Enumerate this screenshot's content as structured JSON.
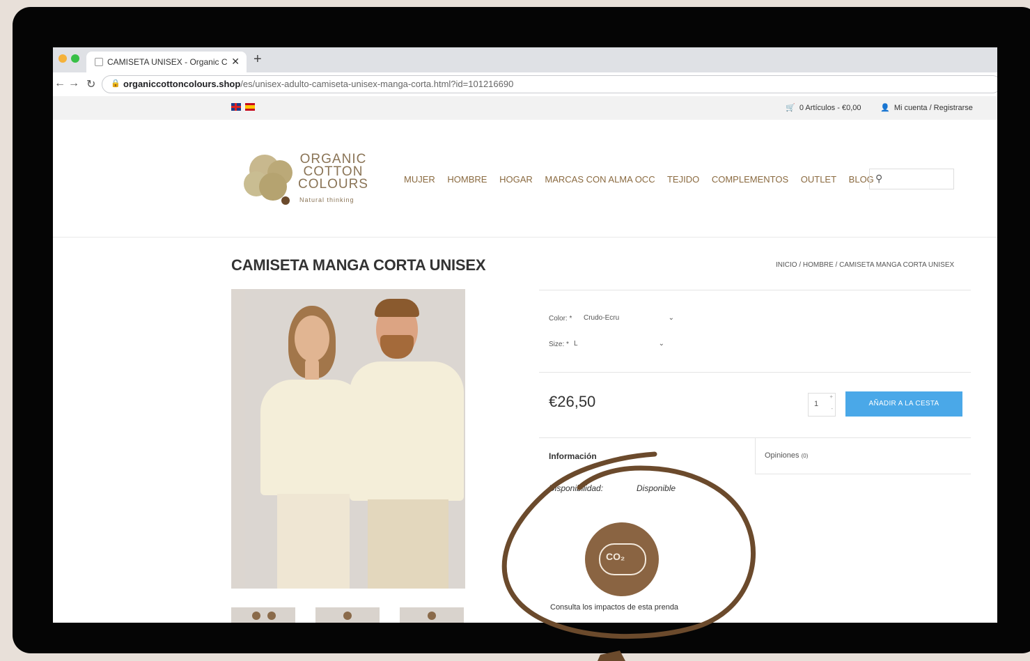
{
  "browser": {
    "tab_title": "CAMISETA UNISEX - Organic C",
    "tab_close": "✕",
    "new_tab": "+",
    "url_host": "organiccottoncolours.shop",
    "url_path": "/es/unisex-adulto-camiseta-unisex-manga-corta.html?id=101216690"
  },
  "topbar": {
    "cart": "0 Artículos - €0,00",
    "account": "Mi cuenta / Registrarse"
  },
  "logo": {
    "line1": "ORGANIC",
    "line2": "COTTON",
    "line3": "COLOURS",
    "tagline": "Natural thinking"
  },
  "nav": {
    "items": [
      "MUJER",
      "HOMBRE",
      "HOGAR",
      "MARCAS CON ALMA OCC",
      "TEJIDO",
      "COMPLEMENTOS",
      "OUTLET",
      "BLOG"
    ]
  },
  "product": {
    "title": "CAMISETA MANGA CORTA UNISEX",
    "breadcrumb": "INICIO / HOMBRE / CAMISETA MANGA CORTA UNISEX",
    "color_label": "Color: *",
    "color_value": "Crudo-Ecru",
    "size_label": "Size: *",
    "size_value": "L",
    "price": "€26,50",
    "qty": "1",
    "add_button": "AÑADIR A LA CESTA",
    "tab_info": "Información",
    "tab_reviews": "Opiniones",
    "tab_reviews_count": "(0)",
    "avail_label": "Disponibilidad:",
    "avail_value": "Disponible",
    "co2_text": "CO₂",
    "consult": "Consulta los impactos de esta prenda"
  },
  "colors": {
    "bezel": "#050505",
    "background": "#e8e0d9",
    "accent_brown": "#6b4a2c",
    "button_blue": "#4aa8e8"
  }
}
